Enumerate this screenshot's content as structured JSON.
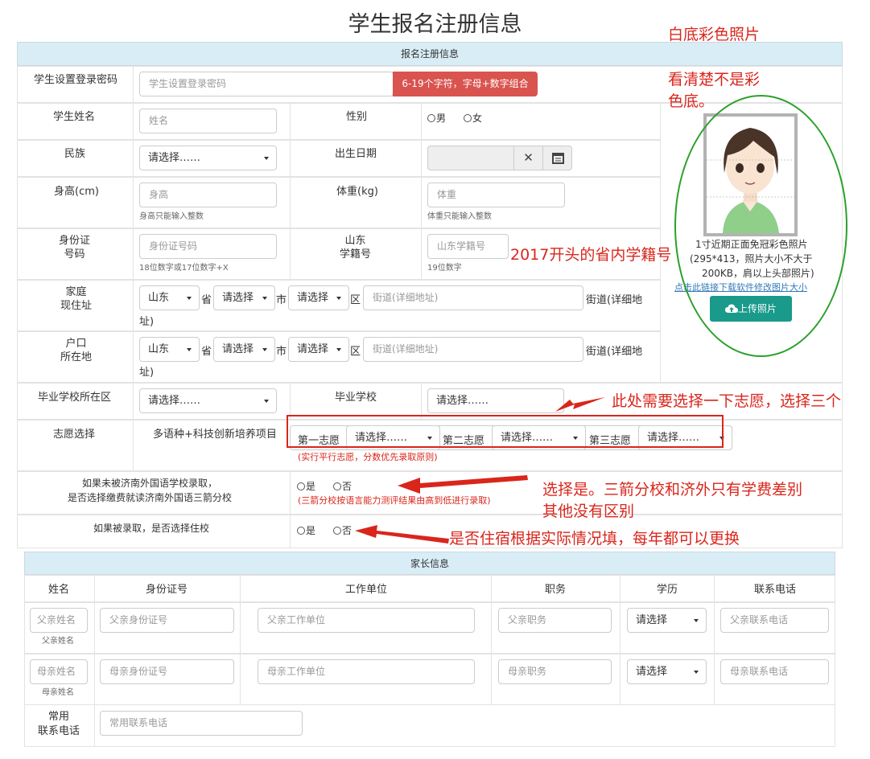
{
  "page": {
    "title": "学生报名注册信息"
  },
  "section1": {
    "header": "报名注册信息"
  },
  "password": {
    "label": "学生设置登录密码",
    "placeholder": "学生设置登录密码",
    "rule": "6-19个字符，字母+数字组合"
  },
  "name": {
    "label": "学生姓名",
    "placeholder": "姓名"
  },
  "gender": {
    "label": "性别",
    "male": "男",
    "female": "女"
  },
  "ethnicity": {
    "label": "民族",
    "value": "请选择……"
  },
  "birth": {
    "label": "出生日期"
  },
  "height": {
    "label": "身高(cm)",
    "placeholder": "身高",
    "hint": "身高只能输入整数"
  },
  "weight": {
    "label": "体重(kg)",
    "placeholder": "体重",
    "hint": "体重只能输入整数"
  },
  "idcard": {
    "label1": "身份证",
    "label2": "号码",
    "placeholder": "身份证号码",
    "hint": "18位数字或17位数字+X"
  },
  "studentno": {
    "label1": "山东",
    "label2": "学籍号",
    "placeholder": "山东学籍号",
    "hint": "19位数字"
  },
  "home": {
    "label1": "家庭",
    "label2": "现住址",
    "province": "山东",
    "city": "请选择",
    "district": "请选择",
    "sheng": "省",
    "shi": "市",
    "qu": "区",
    "street_placeholder": "街道(详细地址)",
    "tail1": "街道(详细地",
    "tail2": "址)"
  },
  "hukou": {
    "label1": "户口",
    "label2": "所在地",
    "province": "山东",
    "city": "请选择",
    "district": "请选择",
    "sheng": "省",
    "shi": "市",
    "qu": "区",
    "street_placeholder": "街道(详细地址)",
    "tail1": "街道(详细地",
    "tail2": "址)"
  },
  "gradschool": {
    "label": "毕业学校所在区",
    "value": "请选择……",
    "school_label": "毕业学校",
    "school_value": "请选择……"
  },
  "wish": {
    "label": "志愿选择",
    "program": "多语种+科技创新培养项目",
    "first": "第一志愿",
    "second": "第二志愿",
    "third": "第三志愿",
    "value": "请选择……",
    "note": "(实行平行志愿，分数优先录取原则)"
  },
  "tuition": {
    "label1": "如果未被济南外国语学校录取，",
    "label2": "是否选择缴费就读济南外国语三箭分校",
    "yes": "是",
    "no": "否",
    "note": "(三箭分校按语言能力测评结果由高到低进行录取)"
  },
  "board": {
    "label": "如果被录取，是否选择住校",
    "yes": "是",
    "no": "否"
  },
  "photo": {
    "caption1": "1寸近期正面免冠彩色照片",
    "caption2": "(295*413，照片大小不大于",
    "caption3": "200KB，肩以上头部照片)",
    "link": "点击此链接下载软件修改图片大小",
    "upload": "上传照片"
  },
  "section2": {
    "header": "家长信息"
  },
  "parents": {
    "columns": [
      "姓名",
      "身份证号",
      "工作单位",
      "职务",
      "学历",
      "联系电话"
    ],
    "father": {
      "name_ph": "父亲姓名",
      "name_hint": "父亲姓名",
      "id_ph": "父亲身份证号",
      "work_ph": "父亲工作单位",
      "job_ph": "父亲职务",
      "edu": "请选择",
      "phone_ph": "父亲联系电话"
    },
    "mother": {
      "name_ph": "母亲姓名",
      "name_hint": "母亲姓名",
      "id_ph": "母亲身份证号",
      "work_ph": "母亲工作单位",
      "job_ph": "母亲职务",
      "edu": "请选择",
      "phone_ph": "母亲联系电话"
    },
    "common": {
      "label1": "常用",
      "label2": "联系电话",
      "phone_ph": "常用联系电话"
    }
  },
  "annotations": {
    "photo1": "白底彩色照片",
    "photo2a": "看清楚不是彩",
    "photo2b": "色底。",
    "studentno": "2017开头的省内学籍号",
    "wish": "此处需要选择一下志愿，选择三个",
    "tuition1": "选择是。三箭分校和济外只有学费差别",
    "tuition2": "其他没有区别",
    "board": "是否住宿根据实际情况填，每年都可以更换"
  },
  "colors": {
    "annotation": "#d9261c",
    "upload_button": "#1a9a8a",
    "header_bg": "#d9edf7",
    "rule_button": "#d9534f",
    "ellipse": "#2ca02c"
  }
}
